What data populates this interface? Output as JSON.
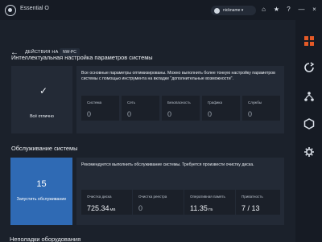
{
  "app": {
    "title": "Essential O",
    "account": "nickname ▾"
  },
  "breadcrumb": {
    "current": "ДЕЙСТВИЯ НА",
    "pc": "NW-PC"
  },
  "optimization": {
    "section_title": "Интеллектуальная настройка параметров системы",
    "status": "Всё отлично",
    "description": "Все основные параметры оптимизированы. Можно выполнить более тонкую настройку параметров системы с помощью инструмента на вкладке \"дополнительные возможности\".",
    "metrics": [
      {
        "label": "Система",
        "value": "0"
      },
      {
        "label": "Сеть",
        "value": "0"
      },
      {
        "label": "Безопасность",
        "value": "0"
      },
      {
        "label": "Графика",
        "value": "0"
      },
      {
        "label": "Службы",
        "value": "0"
      }
    ]
  },
  "maintenance": {
    "section_title": "Обслуживание системы",
    "count": "15",
    "button_label": "Запустить обслуживание",
    "description": "Рекомендуется выполнить обслуживание системы. Требуется произвести очистку диска.",
    "metrics": [
      {
        "label": "Очистка диска",
        "value": "725.34",
        "unit": "MB"
      },
      {
        "label": "Очистка реестра",
        "value": "0",
        "unit": ""
      },
      {
        "label": "Оперативная память",
        "value": "11.35",
        "unit": "ГБ"
      },
      {
        "label": "Приватность",
        "value": "7 / 13",
        "unit": ""
      }
    ]
  },
  "next_section": {
    "title": "Неполадки оборудования"
  },
  "icons": {
    "app": "logo-icon",
    "home": "home-icon",
    "star": "star-icon",
    "help": "help-icon",
    "minimize": "minimize-icon",
    "close": "close-icon",
    "sidebar": [
      "dashboard-icon",
      "refresh-icon",
      "network-icon",
      "hexagon-icon",
      "settings-icon"
    ],
    "accent": "#e55a27"
  }
}
